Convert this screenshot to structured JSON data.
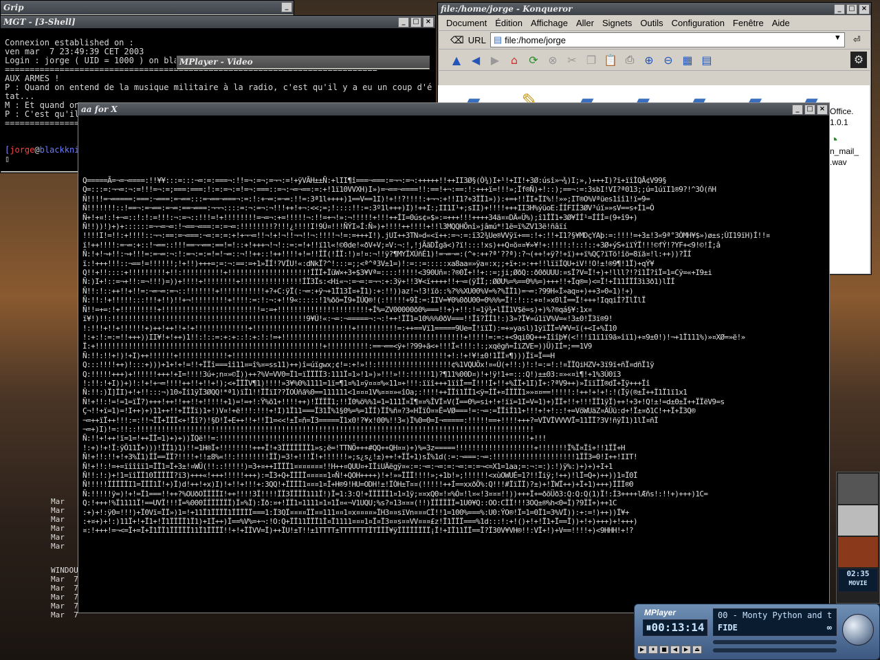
{
  "windows": {
    "grip": {
      "title": "Grip"
    },
    "mgt": {
      "title": "MGT - [3-Shell]",
      "lines": [
        "Connexion established on :",
        "ven mar  7 23:49:39 CET 2003",
        "Login : jorge ( UID = 1000 ) on blackknight.homerezal.lnx ( linux-gnu for i686 )",
        "===========================================================================",
        "AUX ARMES !",
        "",
        "P : Quand on entend de la musique militaire à la radio, c'est qu'il y a eu un coup d'é",
        "tat...",
        "M : Et quand on",
        "P : C'est qu'il",
        "===========================================================================",
        "",
        ""
      ],
      "prompt_user": "jorge",
      "prompt_at": "@",
      "prompt_host": "blackkni",
      "cursor": "▯"
    },
    "mplayer_video": {
      "title": "MPlayer - Video"
    },
    "konqueror": {
      "title": "file:/home/jorge - Konqueror",
      "menu": [
        "Document",
        "Édition",
        "Affichage",
        "Aller",
        "Signets",
        "Outils",
        "Configuration",
        "Fenêtre",
        "Aide"
      ],
      "url_label": "URL",
      "url_value": "file:/home/jorge",
      "file_labels": [
        "Office.",
        "1.0.1",
        "n_mail_",
        ".wav"
      ]
    },
    "aa": {
      "title": "aa for X",
      "ascii_rows": [
        "Q=====Ã=¬=¬====:!!¥¥:::=:::¬=:=:===¬:!!=¬:=¬;=¬¬:=!+ÿVÃH±±Ñ:+lII¶î===¬===:=¬¬:=¬:+++++!!++II3Ø§(Ò¾)I+¹!+II!+3Ø:úsî»¬¾)I;»,)+++I)?ï+ïîÌQÂ¢V99§",
        "Q=:::=:¬¬=:¬:=!!!=¬:=;===:===:!:=:=¬:=!=¬:===::=¬:¬=¬==:=:+!1ï10VVXH)I»)=¬==¬====!!:==!+¬:==:!:+++ï=!!!»;Ïf®Ñ)+!::);==¬:=:3sbI!VI?ª013;;ú=1úïI1®9?!^3Ó(ñH",
        "Ñ!!!!=¬=====:===:¬===:=¬==:::=¬==¬===¬:=:!:+¬=:=¬=:!!=:3ª1l++++)1==V==1I)!+!!?!!!!:+¬¬:+!!I1?+3ÏÏ1»)):+=+!!ÏI+ÏI%!!»»;IT®O%Vªües1îî1!ï=9=",
        "Ñ!!!!!!!::!==¬:=¬==:=¬=:==¬===:¬¬¬::::=:¬:=¬:¬!!!++!+¬:<<;=;!::::!!:=:3º1l+++)I)!++I:;II1I¹+;sII)+!!!!+++II3H%ýüoE:ÍÍFIÍ3ØV³úï»»sV==s+Í1=Ò",
        "Ñ+!+¤!:!+¬=::!:!:=!!!:¬:=¬::!!!=!+!!!!!!!!=¬=¬:+=!!!!!¬:!!=+¬!»:¬!!!!!+!!!++ÍI=0ús¢»$»:=+++!!!++++34ä¤¤DÄ«Ü%);î1ÎÏ1+3Ø¥ÍÍ¹=ÍÍÍ=(9+î9+)",
        "Ñ!!))!)+)+::::::=¬¬=¬=:!¬==¬===:=:=¬=:!!!!!!!!?!!!¿!!!!I!9Ú¤!!!ÑÝI»Í:Ñ»)+!!!!++!!!!+!!l3MQQHÕnî»jâmú*!1ë=ï%ZV13ë!ñâïí",
        "!!!!I!=!!:+!!!!::¬¬:==:=¬===:¬=:=:=:+!+¬¬=!!¬!+!¬!!¬¬!!¬:!!!!¬!=:=+++I!).jUI++3TN»d«<ï++:=¬:=:ï32¾Ue®VVÿï+==:!+:!!+I1?§¥MDçYAþ:=:!!!!=+3±!3«9ª°3ÒMH¥$»)ø±s;ÙI19ïH)Í!!¤",
        "ï!++!!!!:=¬=:+::!¬==::!!!==¬¬==:==!=!::+!+++¬!¬!::=:=!+!!ï1l«!©0de!«ðV+V;¤V:¬:!,!jÃãDÎgä<)?ï!:::!xs)++Q¤ö¤¤¥»¥!+:!!!!:!::!::+3Ø+ýS+ïïÝÏ!!!©fÝ!?YF+<9!©!Í;â",
        "Ñ:!+!¬+!!:¬+!!!=:=¬=:¬:!:=¬:=:=!=!¬=::¬!!++::!++!!!!+!=!!ÎÏ(!ÍÏ:!)¤!¤:¬!!ÿ?¶MYÏXÚñÉ1)!=¬=¬=:(^+:++?ª'??ª):?¬(++!+ÿ?!+ï)++ï%QÇ?ïTö!îö=8ïä¤!l:++))?ÏÍ",
        "ï:!+++!!!::¬==!=!!!!!!;!+!!)+++=;=:¬:==:=+1»ÏÍ!?VÍU!«:dNkÏ?^!:::=;;<ª^ª3V±1=)!:=::=:::::xa8aa¤»ÿa¤:x;;+ï+:»:++!!lïïÍQU+iV!!O!±!®9¶!1Ï)+qÝ¥",
        "Q!!+!!::::+!!!!!!!!!+!!:!!!!!!!!!!+!!!!!!!!!!!!!!!!!!!!ÍÏÏ+ÏüW×+3+$3¥Vª=::::!!!!!<390Uñ¤:?®0Ï+!!+::=;ji;ØðQ::ð0ðUUU:¤sÏ?V=Ï!+)+!lll?!?î1Ï?îÏ=1=Cÿ=«+I9±i",
        "Ñ:)I+!::=¬+!!:=¬!!!)=))+!!!!+!!!!!!!!+!!!!!!!!!!!!!!!ÍÏ3Ïs:<Hi«¬:=¬=:=¬¬:+:3ÿ+!!3¥<ï++++!!+¬=(ÿÍÏ;:ØØU%=%==0%%=)+++!!+Ïq®=)<=Ï!+Í11ÍÏÍ3ì3ð1)lÏÍ",
        "Ñ!!:!::++!!+!!=:¬=¬=:=¬::!!!!!!!+!!!!!!!!!!!+?+C:ÿÏ(:¬=:+ÿ¬+1Ï13Ï¤+Ï1):+:!!))az!¬!3!ïö::%?%%XU00%V=%?%ÏÏ1)=¬=:?99H«Ï»aq¤+)++3»0«1)!+)",
        "Ñ:!!:!+!!!!!:::!!!+!!)!!+¬!!!!!!!!!+!!!!:=:!:¬:+!!9«:::::!1%ðö=Ï9+ÏÚQ®!(:!!!!!+9Ì:=:IIV=¥0%0ðU00=0%%%=Ï!:!:::+¤!»x0lÍ==Ï!+++!IqqiÍ?ÏlÏlÏ",
        "Ñ!!=+=:!+!!!!!!!!!+!!!!!!!!!!!!!!!!!!!!!!!!=:=+!!!!!!!!!!!!!!!!!!!!!!+Í%=ZV00000ð0%===!!+)+!!:!=1ÿ¾+lÏÏ1V$ë=s)+)%?®qá§¥:1x¤",
        "ï¥!)!!:!!!!!!!!!!!!!!!!!!!!!!!!!!!!!!!!!!!!!!!!!!!!!!!9¥Ú!«:¬=:¬=====¬:¬:!++!ÏÏ1=10%%%0ðV===!!Ïî?ÍÍ1!:)3»?Ï¥»ú1ïV%V=«!3±0!Ï3ï®9!",
        "!:!!!+!!+!!!!!!+)++!++!!+!+!!!!!!!!!!!!!+!!!!!!!!!!!!!!!!!!!!!!!!+!!!!!!!!!!=:++==Vï1=====9Ue=Ï!ïïÏ):=+»yasl)1ÿïÏÏ=V¥V=ï(+<I+%Ï10",
        "!:+:!:=:=!!+++))II¥!+!++)1!!:!::=:+:+::!:+:!:!=+!!!!!!!!!!!!!!!!!!!!!!!!!!!!!!!!!!!!!!!!!!!!+!!!!!=:=:+<9qi0Q+++Iîîþ¥(<!!!ï1ï1ï9ã»îï1)+¤9±0!)!¬+1Ï111%)»¤XØ=»ë!»",
        "Ï:+!!!!!!!!!!!!!!!!!!!!!!!!!!!!!!!!!!!!!!!!!!!!!!!!!!!!!!!+!!!!!!!!!!:==¬==<ÿ+!?99+ã<+!!!Ï«!!!:!:;xqëgñ=ÍïZVE=))Ü)IÍ=;==1V9",
        "Ñ:!!:!!+!)!+I)++!!!!!!+!!!!!!!!!!!!+!!!!!!!!!!!!!!!!!!!!!!!!!!!!!!!!!!!!!!!!!!!!!!!!!!!!+!:!+!¥!±0!1ÏÏ¤¶)))Ïï=Ï==H",
        "Q:::!!!!++)!:::+)))+1+!+!=!!+ÏÏî===îî11¤=î%¤=ss11)++)î=úïgwx;¢!=:+!»!!:!!!!!!!!!!!!!!!!!!¢%1VQUÖx!¤«Ú(+!!:)!:!=:=!:!¤ÏÏQiHZV+3ï9ï+ñÏ¤dñÏ1ÿ",
        "Q:!!!!!+++)+!!!!!!+++!+I=!!!!3ú+;n¤»©Ï))++?%V=VV0=Ï1=ïÏÏÏÏ3:111Ï¤1»!1»)»!!!»!!:!!!!!1)?¶11%00D¤)!+!ÿ!1+=:::Q!)±±03:¤»«¤ì¶!+1%3Ú0ï3",
        "!:!!:!+I))+)!:!+!+¬=!!!!++!!+!!+!);<+ÎÏÏV¶1)!!!!»3¥%0%1111=1ï=¶1¤%1¤ÿ¤¤¤%«11¤+!!!:ïïî+++1ïîÎ==Ï!!!Í+!!+%ÍÏ+1I)Ï+:?ªV9++)»ÏïïÏÏ®dÏ+Ïÿ+++Ïî",
        "Ñ:!!:)Ï]ÏI)+!+!!:::¬)10»Ïî1ÿÏ3ØQQ!*ª1)ïÏ1!!ÏÏïI??ÏOÙñã%0==111111<1¤¤¤1V%¤¤¤»«îOa;:!!!!++ÏÏî1ÏÏ1<ÿ=ÍÏ+¤ÍÏÏÏ1»»¤¤==!!!!!:!++!+!+!:!(Ïÿ(®±Í++Ï1Ï1ï1x1",
        "Ñ!+!!:!=!=1=ïÏ?)+++!++!!++!!+!!!!!+1)=!=+!:Ÿ%õ1+!!!!++)!ÏÏÏÏ1;!!Ï0%ö%%1=1=111Ï¤Ï¶¤¤%ÎVÏ¤V(Ï==0%=si+!+!ïï=1I=V=1)+)ÏÏ+!!+!!!ÏÏ1ÿÏ)++!+3+!Q!±!=d±0±Ï++ÏÏëV9=s",
        "Ç¬!!+ï=1)=!I++)+)11++!!+ÏÏÏï)1+!)V¤!+ë!!!:!!!+!I)1Ï11===Ï31Ï%1§0%=%=1ÏÍ)ÏÍ%ñ¤?3«HÏïÒ¤¤Ë=VØ===!=:¬=:=ÏÏîÍ11+!!!+!+!::!+=VöWUäZ¤ÄÛü:d+!Ï±¤ð1C!++Ï+Ï3Q®",
        "¬=++ïÏ++!!!:=:!!¬ÏÏ+ÏÏÏ<+!Ïî?)!§D!Ï+E++!!+!!Ï1=<<!±Ï¤ñ=Ï3=====Ï1x0!?¥x!00%!!3«)Ï%0=0=I¬=====:!!!!!==+!!!!+++?=VÏVÏVVVVÏ=11ÏÏ?3V!ñÿÏ1)1lÏ¤ñÏ",
        "¬=+)I)!=:!!::!!!!!!!!!!!!!!!!!!!!!!!!!!!!!!!!!!!!!!!!!!!!!!!!!!!!!!!!!!!!!!!!!!!!!!!!!!!!!!!!!!!!!!!!!!!!!!!!",
        "Ñ:!!+!++!ï=1=!++ÏÏ=1)+)+))ÏQë!!=:!!!!!!!!!!!!!!!!!!!!!!!!!!!!!!!!!!!!!!!!!!!!!!!!!!!!!!!!!!!!!!!!!!!!!!!!!!!+!!!",
        "!:+)!+!Ï:ÿÔ11Ï+)))!ÏÏ1)1)!!=1H®Ï+!!!!!!!!+++Ï!+3ÏÏÏÏÏÏÏ1»s;ë=!TTNÖ+++#QQ++QH¤¤)+)%=3z=====!!!!!!!!!!!!!!!!!!!+!!!!!!!Ï%Ï¤Ïî+!!1ÏÏ+H",
        "Ñ!+!!:!!+!+3%Ï1)ÏÏ==ÏÏ?!!!!+!!±8%«!!:!!!!!!!!ÏÏ)=3!+!!!Ï!+!!!!!!»;s¿s¿!±)++!+ÏÏ+1)sÏ%1d(:=:¬===:¬=:!!!!!!!!!!!!!!!!!!!!1ÏÏ3=0!I++!IIT!",
        "Ñ!+!!:!=+=ïîîîï1=ÏÏ1=Ï+3±!¤WÜ(!!::!!!!!)=3+¤++IÏÏÏ1¤¤¤¤¤¤¤!!H++¤QUU¤+IÏiUÄëgÿ¤«:=:¬=:¬=:=:¬=:=:=¬<=X1=1aa;=:¬:=:):!)ÿ%:)+)+)+I+1",
        "Ñ!!:!:)+!1=ïîÏÏ10ÏÏÏÏÏ?ï3)+++«!+++!!!!!+++):=Ï3+Q+ÏÏÏÏ¤¤¤¤¤1¤Ñ!+QOH++++)!+!»»ÏÏÏ!!!!»;+1b!»;!!!!!!<xùOWUÉ=1?!!Ïiÿ;!++)!lÏ=Q+)++))1¤Ï0Ï",
        "Ñ!!!!!ÏÍÏÏÏI1=ÏÏÏ1Ï!+)Ï)d!++!+x)I)!+!!+!!!+:3QQ!+ÏÏÏÏ1¤¤¤1¤Ï+H®9!HU=ODH!±!ÏÒH±T¤¤(!!!!!++Í==xxðÖ%:Q!!!#ÏïÏÏ)?±)+!ÏWÏ++)+Ï+1)+++)ÏÏÏ®0",
        "Ñ:!!!!!ÿ=)!+!=Ï1===!!++?%OUðOÏÏÏÏI!++!!!!3Ï!!!!ÏÏ3ÏÏÏÏ111Ï!)Ï=1:3:Q!+ÏÏÏÏÏ1¤1¤1ÿ;¤¤xQ0¤!¤%Ó¤!l¤«!3¤¤¤!!))+++Ï+=ðõÜð3:Q:Q:Q(1)Ï!:Í3++++lÆñs!:!!+)+++)1C=",
        "Q:!+++!%Ï1111Ï!==UVÏ!!!Ï=%000ÍÍÏÏÏÏÏ)Ï¤%Ï):Ïð:¤+!ÏÏ1¤1111¤1¤1Ï¤«¬V1UQU;%s?¤13¤¤¤(!!)ÏÏÏÏÏÏ=1U0¥Q::OO:CÏÏ!!!3OQ±®%h<0=Ï)?9ÏÏ+)++1C",
        ":+)+!:ÿ0=!!!)+Ï0Vï=ÏÏ»)1=!+11Ï1ÏÏÏÏ1ÏÏÏÏÏ===1:Ï3QÏ¤¤¤¤ÏÏ¤¤111¤¤1¤x¤¤¤¤»ÏH3¤¤sïVn¤¤¤CÏ!!1=100%===%:U0:ÝO®!Ï=1=0Ï1=3%VÏ)):+:=!)++))Ï¥+",
        ":+¤+)+!:)11Ï+!+Ï1+!Ï1ÏÏÏÏ1Ï1)+IÏ++)Ï==%V%=+¬:!O:Q+ÏÏ11ÏÏÏ1Ï¤Ï1111¤¤¤1¤Ï¤Ï3¤¤s¤¤VV¤¤¤£z!Ï1ÏÏÏ===%1d:::!:+!()+!+!Ï1+Ï==Ï))+!+)+++)+!+++)",
        "¤:!+++!=¬<=Ï+=Ï+Ï1ÏÏ1ÏÏÏÏÏ11Ï1ÏÏÏÏ!!+!+ÏÏVV=Ï)++ÏU!±T!!±1TTTT±TTTTTTTÏTÏÏÏ¥ÿÏÏÏÏÏÏÏÏ¡Ï!+IÏ11ÏÏ==Ï?Ï30V¥VH®!!:VÏ+!)+V==!!!!+)<9HHH!+!?"
      ]
    }
  },
  "desktop": {
    "ls_lines_a": [
      "Mar",
      "Mar",
      "Mar",
      "Mar",
      "Mar",
      "Mar"
    ],
    "windows_label": "WINDOU",
    "ls_lines_b": [
      "Mar  7",
      "Mar  7",
      "Mar  7",
      "Mar  7",
      "Mar  7"
    ]
  },
  "mplayer": {
    "title": "MPlayer",
    "time": "00:13:14",
    "track": "00 - Monty Python and the",
    "status_text": "FIDE",
    "mode": "MOVIE",
    "clock": "02:35"
  }
}
